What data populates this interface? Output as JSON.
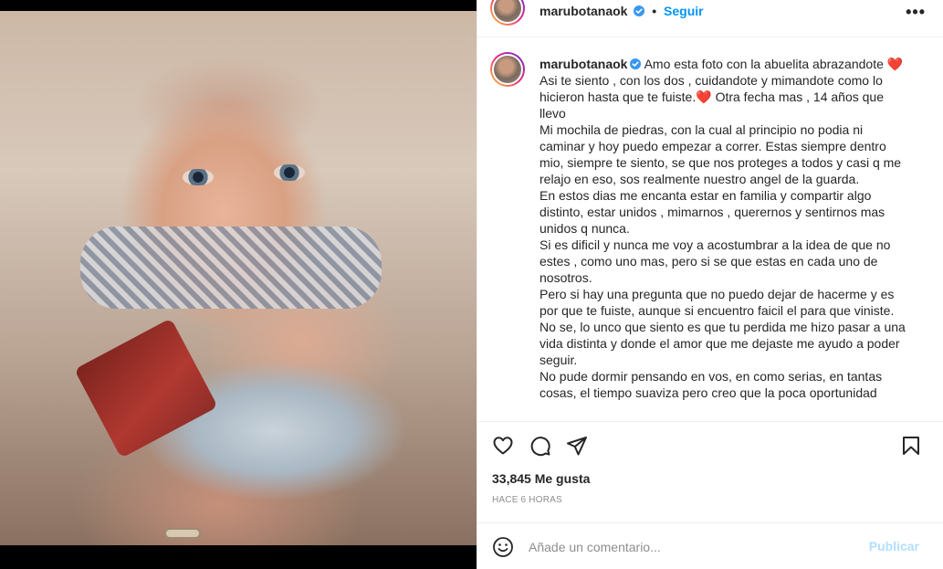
{
  "post": {
    "username": "marubotanaok",
    "verified": true,
    "separator": "•",
    "follow_label": "Seguir",
    "more_label": "•••"
  },
  "caption": {
    "username": "marubotanaok",
    "intro": "Amo esta foto con la abuelita abrazandote",
    "line1": "Asi te siento , con los dos , cuidandote y mimandote como lo hicieron hasta que te fuiste.",
    "line1b": "Otra fecha mas , 14 años que llevo",
    "p2": "Mi mochila de piedras, con la cual al principio no podia ni caminar y hoy puedo empezar a correr. Estas siempre dentro mio, siempre te siento, se que nos proteges a todos y casi q me relajo en eso, sos realmente nuestro angel de la guarda.",
    "p3": "En estos dias me encanta estar en familia y compartir algo distinto, estar unidos , mimarnos , querernos y sentirnos mas unidos q nunca.",
    "p4": "Si es dificil y nunca me voy a acostumbrar a la idea de que no estes , como uno mas, pero si se que estas en cada uno de nosotros.",
    "p5": "Pero si hay una pregunta que no puedo dejar de hacerme y es por que te fuiste, aunque si encuentro faicil el para que viniste.",
    "p6": "No se, lo unco que siento es que tu perdida me hizo pasar a una vida distinta y donde el amor que me dejaste me ayudo a poder seguir.",
    "p7": "No pude dormir pensando en vos, en como serias, en tantas cosas, el tiempo suaviza pero creo que la poca oportunidad",
    "heart": "❤️"
  },
  "stats": {
    "likes": "33,845 Me gusta",
    "time": "HACE 6 HORAS"
  },
  "comment": {
    "placeholder": "Añade un comentario...",
    "publish_label": "Publicar"
  },
  "icons": {
    "like": "heart-icon",
    "comment": "comment-icon",
    "share": "share-icon",
    "save": "bookmark-icon",
    "emoji": "emoji-icon",
    "verified": "verified-badge-icon",
    "more": "more-options-icon"
  },
  "colors": {
    "accent": "#0095f6",
    "publish_disabled": "#b2dffc",
    "heart": "#ed4956",
    "secondary_text": "#8e8e8e",
    "border": "#efefef"
  }
}
